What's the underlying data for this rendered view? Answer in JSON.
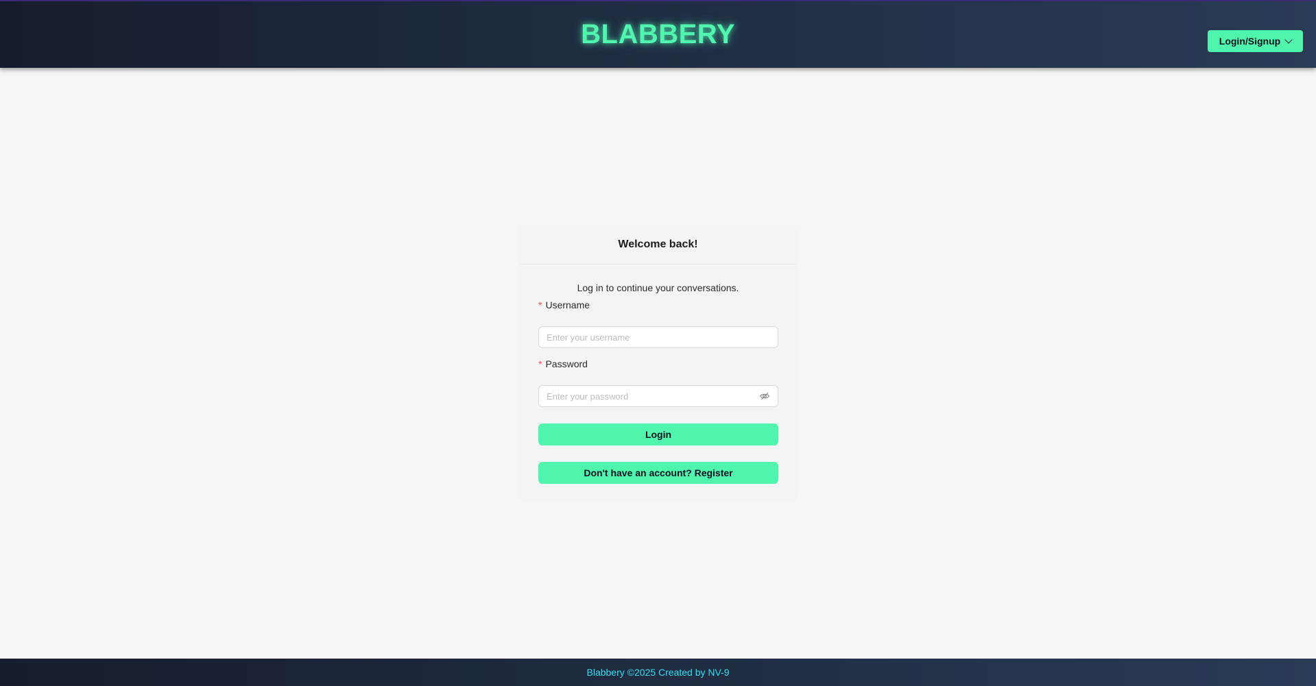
{
  "header": {
    "brand": "BLABBERY",
    "auth_menu_label": "Login/Signup"
  },
  "login_card": {
    "title": "Welcome back!",
    "subtitle": "Log in to continue your conversations.",
    "username": {
      "required_mark": "*",
      "label": "Username",
      "placeholder": "Enter your username",
      "value": ""
    },
    "password": {
      "required_mark": "*",
      "label": "Password",
      "placeholder": "Enter your password",
      "value": "",
      "toggle_icon": "eye-invisible-icon"
    },
    "login_button": "Login",
    "register_button": "Don't have an account? Register"
  },
  "footer": {
    "text": "Blabbery ©2025 Created by NV-9"
  },
  "colors": {
    "accent": "#4ff5ad",
    "header_bg": "#1f2c42",
    "footer_text": "#35dff0",
    "page_bg": "#f5f5f5",
    "required": "#ff4d4f"
  }
}
